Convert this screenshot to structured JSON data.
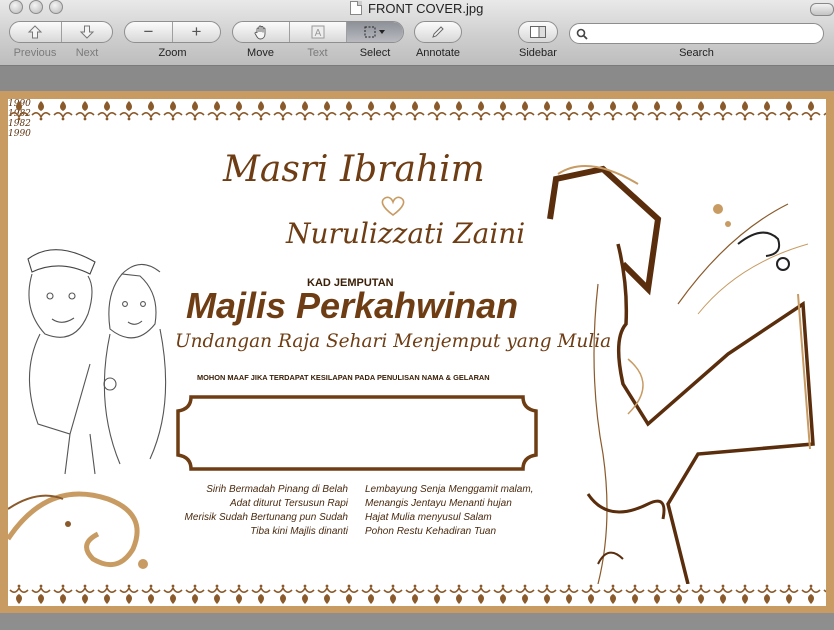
{
  "window": {
    "title": "FRONT COVER.jpg"
  },
  "toolbar": {
    "previous_label": "Previous",
    "next_label": "Next",
    "zoom_label": "Zoom",
    "move_label": "Move",
    "text_label": "Text",
    "select_label": "Select",
    "annotate_label": "Annotate",
    "sidebar_label": "Sidebar",
    "search_label": "Search",
    "search_value": ""
  },
  "card": {
    "year_groom": "1982",
    "groom_name": "Masri Ibrahim",
    "year_bride": "1990",
    "bride_name": "Nurulizzati Zaini",
    "kad_jemputan": "KAD JEMPUTAN",
    "main_title": "Majlis Perkahwinan",
    "subtitle": "Undangan Raja Sehari Menjemput yang Mulia",
    "notice": "MOHON MAAF JIKA TERDAPAT KESILAPAN PADA PENULISAN NAMA & GELARAN",
    "caricature_year_bride": "1990",
    "caricature_year_groom": "1982",
    "poem_left": [
      "Sirih Bermadah Pinang di Belah",
      "Adat diturut Tersusun Rapi",
      "Merisik Sudah Bertunang pun Sudah",
      "Tiba kini Majlis dinanti"
    ],
    "poem_right": [
      "Lembayung Senja Menggamit malam,",
      "Menangis Jentayu Menanti hujan",
      "Hajat Mulia menyusul Salam",
      "Pohon Restu Kehadiran Tuan"
    ]
  },
  "colors": {
    "brown": "#6e3d14",
    "tan": "#c89b63",
    "border_motif": "#8a5a2b"
  }
}
